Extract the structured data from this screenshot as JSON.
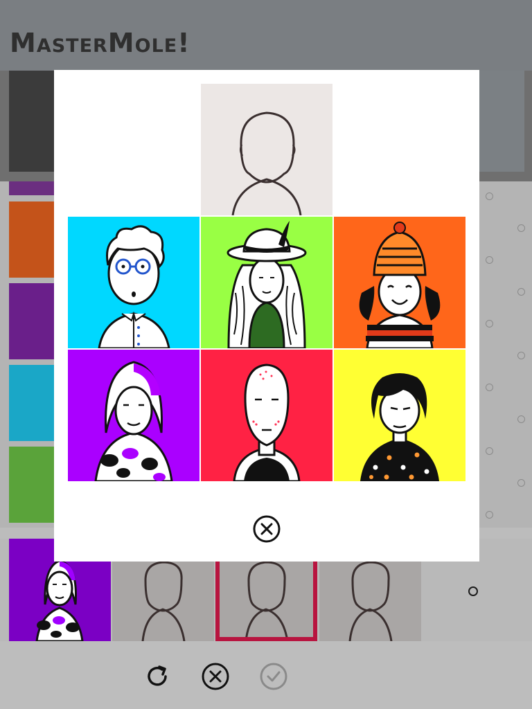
{
  "app": {
    "title": "MasterMole!"
  },
  "colors": {
    "header_bg": "#7a7e82",
    "selected_border": "#b8143f",
    "blank_avatar_bg": "#ece7e5"
  },
  "modal": {
    "blank_choice_icon": "blank-avatar-icon",
    "choices": [
      {
        "name": "curly-hair-glasses-man",
        "bg": "#00d8ff"
      },
      {
        "name": "white-hat-long-hair-woman",
        "bg": "#99ff44"
      },
      {
        "name": "beanie-smiling-woman",
        "bg": "#ff661a"
      },
      {
        "name": "purple-streak-hair-woman",
        "bg": "#aa00ff"
      },
      {
        "name": "bald-man",
        "bg": "#ff2244"
      },
      {
        "name": "bob-hair-polka-woman",
        "bg": "#ffff33"
      }
    ],
    "close_icon": "close-circle-icon"
  },
  "toolbar": {
    "refresh_icon": "refresh-icon",
    "cancel_icon": "close-circle-icon",
    "submit_icon": "check-circle-icon"
  }
}
